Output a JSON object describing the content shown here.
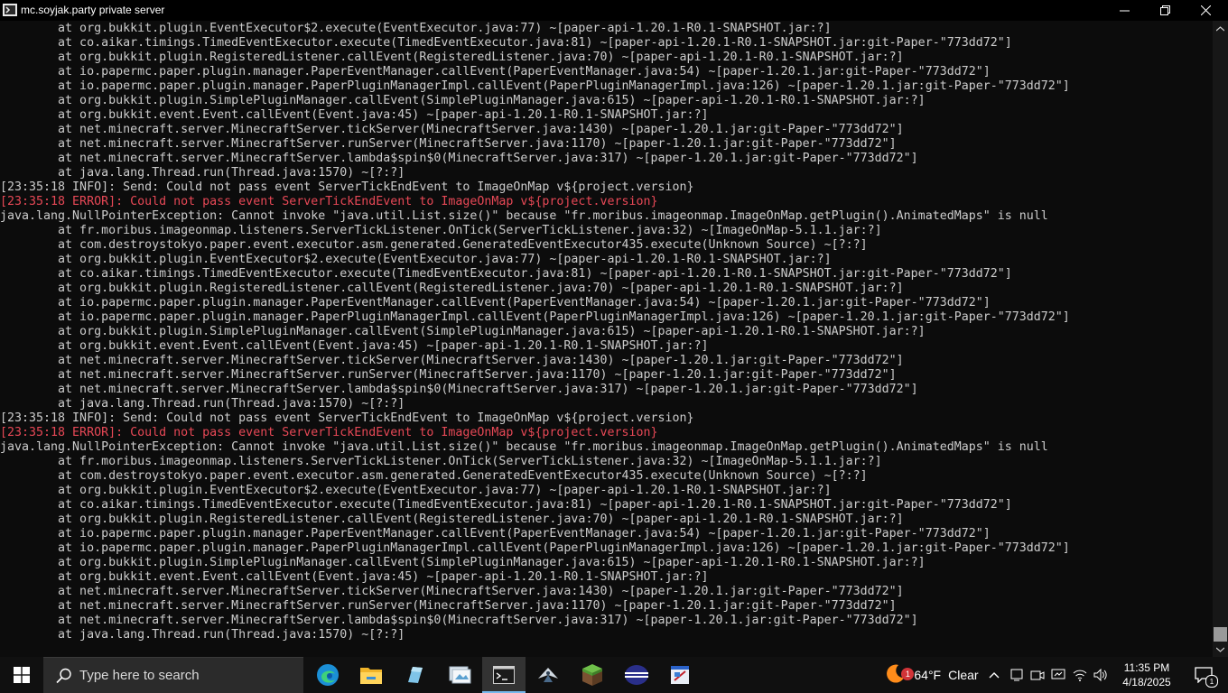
{
  "window": {
    "title": "mc.soyjak.party private server"
  },
  "console": {
    "lines": [
      {
        "type": "info",
        "text": "        at org.bukkit.plugin.EventExecutor$2.execute(EventExecutor.java:77) ~[paper-api-1.20.1-R0.1-SNAPSHOT.jar:?]"
      },
      {
        "type": "info",
        "text": "        at co.aikar.timings.TimedEventExecutor.execute(TimedEventExecutor.java:81) ~[paper-api-1.20.1-R0.1-SNAPSHOT.jar:git-Paper-\"773dd72\"]"
      },
      {
        "type": "info",
        "text": "        at org.bukkit.plugin.RegisteredListener.callEvent(RegisteredListener.java:70) ~[paper-api-1.20.1-R0.1-SNAPSHOT.jar:?]"
      },
      {
        "type": "info",
        "text": "        at io.papermc.paper.plugin.manager.PaperEventManager.callEvent(PaperEventManager.java:54) ~[paper-1.20.1.jar:git-Paper-\"773dd72\"]"
      },
      {
        "type": "info",
        "text": "        at io.papermc.paper.plugin.manager.PaperPluginManagerImpl.callEvent(PaperPluginManagerImpl.java:126) ~[paper-1.20.1.jar:git-Paper-\"773dd72\"]"
      },
      {
        "type": "info",
        "text": "        at org.bukkit.plugin.SimplePluginManager.callEvent(SimplePluginManager.java:615) ~[paper-api-1.20.1-R0.1-SNAPSHOT.jar:?]"
      },
      {
        "type": "info",
        "text": "        at org.bukkit.event.Event.callEvent(Event.java:45) ~[paper-api-1.20.1-R0.1-SNAPSHOT.jar:?]"
      },
      {
        "type": "info",
        "text": "        at net.minecraft.server.MinecraftServer.tickServer(MinecraftServer.java:1430) ~[paper-1.20.1.jar:git-Paper-\"773dd72\"]"
      },
      {
        "type": "info",
        "text": "        at net.minecraft.server.MinecraftServer.runServer(MinecraftServer.java:1170) ~[paper-1.20.1.jar:git-Paper-\"773dd72\"]"
      },
      {
        "type": "info",
        "text": "        at net.minecraft.server.MinecraftServer.lambda$spin$0(MinecraftServer.java:317) ~[paper-1.20.1.jar:git-Paper-\"773dd72\"]"
      },
      {
        "type": "info",
        "text": "        at java.lang.Thread.run(Thread.java:1570) ~[?:?]"
      },
      {
        "type": "info",
        "text": "[23:35:18 INFO]: Send: Could not pass event ServerTickEndEvent to ImageOnMap v${project.version}"
      },
      {
        "type": "error",
        "text": "[23:35:18 ERROR]: Could not pass event ServerTickEndEvent to ImageOnMap v${project.version}"
      },
      {
        "type": "info",
        "text": "java.lang.NullPointerException: Cannot invoke \"java.util.List.size()\" because \"fr.moribus.imageonmap.ImageOnMap.getPlugin().AnimatedMaps\" is null"
      },
      {
        "type": "info",
        "text": "        at fr.moribus.imageonmap.listeners.ServerTickListener.OnTick(ServerTickListener.java:32) ~[ImageOnMap-5.1.1.jar:?]"
      },
      {
        "type": "info",
        "text": "        at com.destroystokyo.paper.event.executor.asm.generated.GeneratedEventExecutor435.execute(Unknown Source) ~[?:?]"
      },
      {
        "type": "info",
        "text": "        at org.bukkit.plugin.EventExecutor$2.execute(EventExecutor.java:77) ~[paper-api-1.20.1-R0.1-SNAPSHOT.jar:?]"
      },
      {
        "type": "info",
        "text": "        at co.aikar.timings.TimedEventExecutor.execute(TimedEventExecutor.java:81) ~[paper-api-1.20.1-R0.1-SNAPSHOT.jar:git-Paper-\"773dd72\"]"
      },
      {
        "type": "info",
        "text": "        at org.bukkit.plugin.RegisteredListener.callEvent(RegisteredListener.java:70) ~[paper-api-1.20.1-R0.1-SNAPSHOT.jar:?]"
      },
      {
        "type": "info",
        "text": "        at io.papermc.paper.plugin.manager.PaperEventManager.callEvent(PaperEventManager.java:54) ~[paper-1.20.1.jar:git-Paper-\"773dd72\"]"
      },
      {
        "type": "info",
        "text": "        at io.papermc.paper.plugin.manager.PaperPluginManagerImpl.callEvent(PaperPluginManagerImpl.java:126) ~[paper-1.20.1.jar:git-Paper-\"773dd72\"]"
      },
      {
        "type": "info",
        "text": "        at org.bukkit.plugin.SimplePluginManager.callEvent(SimplePluginManager.java:615) ~[paper-api-1.20.1-R0.1-SNAPSHOT.jar:?]"
      },
      {
        "type": "info",
        "text": "        at org.bukkit.event.Event.callEvent(Event.java:45) ~[paper-api-1.20.1-R0.1-SNAPSHOT.jar:?]"
      },
      {
        "type": "info",
        "text": "        at net.minecraft.server.MinecraftServer.tickServer(MinecraftServer.java:1430) ~[paper-1.20.1.jar:git-Paper-\"773dd72\"]"
      },
      {
        "type": "info",
        "text": "        at net.minecraft.server.MinecraftServer.runServer(MinecraftServer.java:1170) ~[paper-1.20.1.jar:git-Paper-\"773dd72\"]"
      },
      {
        "type": "info",
        "text": "        at net.minecraft.server.MinecraftServer.lambda$spin$0(MinecraftServer.java:317) ~[paper-1.20.1.jar:git-Paper-\"773dd72\"]"
      },
      {
        "type": "info",
        "text": "        at java.lang.Thread.run(Thread.java:1570) ~[?:?]"
      },
      {
        "type": "info",
        "text": "[23:35:18 INFO]: Send: Could not pass event ServerTickEndEvent to ImageOnMap v${project.version}"
      },
      {
        "type": "error",
        "text": "[23:35:18 ERROR]: Could not pass event ServerTickEndEvent to ImageOnMap v${project.version}"
      },
      {
        "type": "info",
        "text": "java.lang.NullPointerException: Cannot invoke \"java.util.List.size()\" because \"fr.moribus.imageonmap.ImageOnMap.getPlugin().AnimatedMaps\" is null"
      },
      {
        "type": "info",
        "text": "        at fr.moribus.imageonmap.listeners.ServerTickListener.OnTick(ServerTickListener.java:32) ~[ImageOnMap-5.1.1.jar:?]"
      },
      {
        "type": "info",
        "text": "        at com.destroystokyo.paper.event.executor.asm.generated.GeneratedEventExecutor435.execute(Unknown Source) ~[?:?]"
      },
      {
        "type": "info",
        "text": "        at org.bukkit.plugin.EventExecutor$2.execute(EventExecutor.java:77) ~[paper-api-1.20.1-R0.1-SNAPSHOT.jar:?]"
      },
      {
        "type": "info",
        "text": "        at co.aikar.timings.TimedEventExecutor.execute(TimedEventExecutor.java:81) ~[paper-api-1.20.1-R0.1-SNAPSHOT.jar:git-Paper-\"773dd72\"]"
      },
      {
        "type": "info",
        "text": "        at org.bukkit.plugin.RegisteredListener.callEvent(RegisteredListener.java:70) ~[paper-api-1.20.1-R0.1-SNAPSHOT.jar:?]"
      },
      {
        "type": "info",
        "text": "        at io.papermc.paper.plugin.manager.PaperEventManager.callEvent(PaperEventManager.java:54) ~[paper-1.20.1.jar:git-Paper-\"773dd72\"]"
      },
      {
        "type": "info",
        "text": "        at io.papermc.paper.plugin.manager.PaperPluginManagerImpl.callEvent(PaperPluginManagerImpl.java:126) ~[paper-1.20.1.jar:git-Paper-\"773dd72\"]"
      },
      {
        "type": "info",
        "text": "        at org.bukkit.plugin.SimplePluginManager.callEvent(SimplePluginManager.java:615) ~[paper-api-1.20.1-R0.1-SNAPSHOT.jar:?]"
      },
      {
        "type": "info",
        "text": "        at org.bukkit.event.Event.callEvent(Event.java:45) ~[paper-api-1.20.1-R0.1-SNAPSHOT.jar:?]"
      },
      {
        "type": "info",
        "text": "        at net.minecraft.server.MinecraftServer.tickServer(MinecraftServer.java:1430) ~[paper-1.20.1.jar:git-Paper-\"773dd72\"]"
      },
      {
        "type": "info",
        "text": "        at net.minecraft.server.MinecraftServer.runServer(MinecraftServer.java:1170) ~[paper-1.20.1.jar:git-Paper-\"773dd72\"]"
      },
      {
        "type": "info",
        "text": "        at net.minecraft.server.MinecraftServer.lambda$spin$0(MinecraftServer.java:317) ~[paper-1.20.1.jar:git-Paper-\"773dd72\"]"
      },
      {
        "type": "info",
        "text": "        at java.lang.Thread.run(Thread.java:1570) ~[?:?]"
      }
    ],
    "colors": {
      "text": "#cccccc",
      "error": "#e74856",
      "background": "#0c0c0c"
    }
  },
  "taskbar": {
    "search_placeholder": "Type here to search",
    "apps": [
      {
        "icon": "edge-icon"
      },
      {
        "icon": "file-explorer-icon"
      },
      {
        "icon": "app-icon"
      },
      {
        "icon": "app-icon"
      },
      {
        "icon": "terminal-icon",
        "active": true
      },
      {
        "icon": "app-icon"
      },
      {
        "icon": "minecraft-icon"
      },
      {
        "icon": "app-icon"
      },
      {
        "icon": "app-icon"
      }
    ],
    "weather": {
      "temp": "64°F",
      "condition": "Clear",
      "badge": "1"
    },
    "clock": {
      "time": "11:35 PM",
      "date": "4/18/2025"
    },
    "notifications": {
      "count": "1"
    }
  }
}
